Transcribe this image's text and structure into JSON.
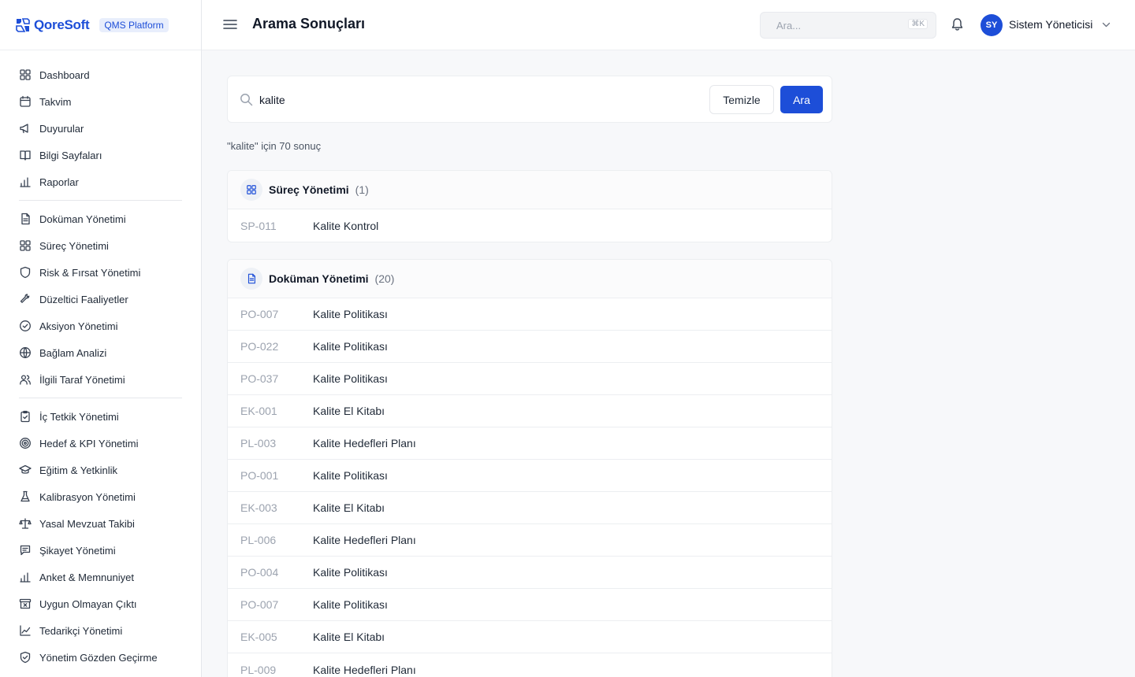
{
  "brand": {
    "name": "QoreSoft",
    "badge": "QMS Platform"
  },
  "sidebar": {
    "groups": [
      [
        {
          "label": "Dashboard",
          "icon": "grid-icon"
        },
        {
          "label": "Takvim",
          "icon": "calendar-icon"
        },
        {
          "label": "Duyurular",
          "icon": "megaphone-icon"
        },
        {
          "label": "Bilgi Sayfaları",
          "icon": "book-icon"
        },
        {
          "label": "Raporlar",
          "icon": "bar-chart-icon"
        }
      ],
      [
        {
          "label": "Doküman Yönetimi",
          "icon": "document-icon"
        },
        {
          "label": "Süreç Yönetimi",
          "icon": "grid-icon"
        },
        {
          "label": "Risk & Fırsat Yönetimi",
          "icon": "shield-icon"
        },
        {
          "label": "Düzeltici Faaliyetler",
          "icon": "wrench-icon"
        },
        {
          "label": "Aksiyon Yönetimi",
          "icon": "check-circle-icon"
        },
        {
          "label": "Bağlam Analizi",
          "icon": "globe-icon"
        },
        {
          "label": "İlgili Taraf Yönetimi",
          "icon": "users-icon"
        }
      ],
      [
        {
          "label": "İç Tetkik Yönetimi",
          "icon": "clipboard-check-icon"
        },
        {
          "label": "Hedef & KPI Yönetimi",
          "icon": "target-icon"
        },
        {
          "label": "Eğitim & Yetkinlik",
          "icon": "graduation-cap-icon"
        },
        {
          "label": "Kalibrasyon Yönetimi",
          "icon": "flask-icon"
        },
        {
          "label": "Yasal Mevzuat Takibi",
          "icon": "scale-icon"
        },
        {
          "label": "Şikayet Yönetimi",
          "icon": "message-icon"
        },
        {
          "label": "Anket & Memnuniyet",
          "icon": "bar-chart-icon"
        },
        {
          "label": "Uygun Olmayan Çıktı",
          "icon": "archive-x-icon"
        },
        {
          "label": "Tedarikçi Yönetimi",
          "icon": "line-chart-icon"
        },
        {
          "label": "Yönetim Gözden Geçirme",
          "icon": "shield-check-icon"
        }
      ]
    ]
  },
  "header": {
    "title": "Arama Sonuçları",
    "search_placeholder": "Ara...",
    "shortcut": "⌘K",
    "user_initials": "SY",
    "user_name": "Sistem Yöneticisi"
  },
  "search": {
    "query": "kalite",
    "clear_label": "Temizle",
    "submit_label": "Ara",
    "result_text": "\"kalite\" için 70 sonuç"
  },
  "result_groups": [
    {
      "title": "Süreç Yönetimi",
      "count": "(1)",
      "icon": "grid-icon",
      "items": [
        {
          "code": "SP-011",
          "title": "Kalite Kontrol"
        }
      ]
    },
    {
      "title": "Doküman Yönetimi",
      "count": "(20)",
      "icon": "document-icon",
      "items": [
        {
          "code": "PO-007",
          "title": "Kalite Politikası"
        },
        {
          "code": "PO-022",
          "title": "Kalite Politikası"
        },
        {
          "code": "PO-037",
          "title": "Kalite Politikası"
        },
        {
          "code": "EK-001",
          "title": "Kalite El Kitabı"
        },
        {
          "code": "PL-003",
          "title": "Kalite Hedefleri Planı"
        },
        {
          "code": "PO-001",
          "title": "Kalite Politikası"
        },
        {
          "code": "EK-003",
          "title": "Kalite El Kitabı"
        },
        {
          "code": "PL-006",
          "title": "Kalite Hedefleri Planı"
        },
        {
          "code": "PO-004",
          "title": "Kalite Politikası"
        },
        {
          "code": "PO-007",
          "title": "Kalite Politikası"
        },
        {
          "code": "EK-005",
          "title": "Kalite El Kitabı"
        },
        {
          "code": "PL-009",
          "title": "Kalite Hedefleri Planı"
        }
      ]
    }
  ],
  "colors": {
    "accent": "#1d4ed8",
    "code_text": "#9ca3af",
    "border": "#eceef1"
  }
}
